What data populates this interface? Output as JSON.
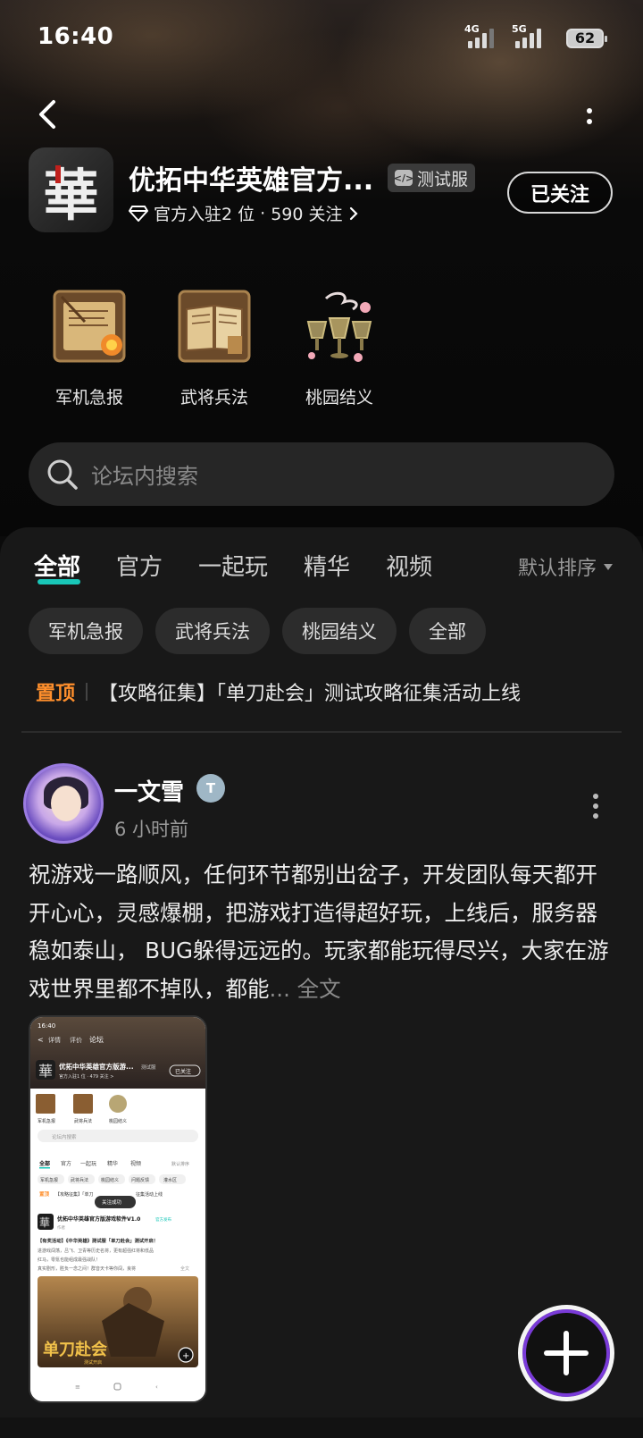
{
  "status_bar": {
    "time": "16:40",
    "signal1": "4G",
    "signal2": "5G",
    "battery": "62"
  },
  "header": {
    "title": "优拓中华英雄官方...",
    "badge": "测试服",
    "rank": "官方入驻2 位",
    "follow_count": "590 关注",
    "follow_button": "已关注",
    "logo_text": "華"
  },
  "categories": [
    {
      "label": "军机急报",
      "icon": "scroll-icon"
    },
    {
      "label": "武将兵法",
      "icon": "book-icon"
    },
    {
      "label": "桃园结义",
      "icon": "goblets-icon"
    }
  ],
  "search": {
    "placeholder": "论坛内搜索"
  },
  "tabs": [
    "全部",
    "官方",
    "一起玩",
    "精华",
    "视频"
  ],
  "sort": {
    "label": "默认排序"
  },
  "chips": [
    "军机急报",
    "武将兵法",
    "桃园结义",
    "全部"
  ],
  "pinned": {
    "tag": "置顶",
    "text": "【攻略征集】「单刀赴会」测试攻略征集活动上线"
  },
  "post": {
    "username": "一文雪",
    "time": "6 小时前",
    "content": "祝游戏一路顺风，任何环节都别出岔子，开发团队每天都开开心心，灵感爆棚，把游戏打造得超好玩，上线后，服务器稳如泰山， BUG躲得远远的。玩家都能玩得尽兴，大家在游戏世界里都不掉队，都能",
    "ellipsis": "... 全文"
  },
  "thumbnail": {
    "time": "16:40",
    "nav": [
      "详情",
      "评价",
      "论坛"
    ],
    "title": "优拓中华英雄官方版游...",
    "badge": "测试服",
    "sub": "官方入驻1 位 · 479 关注 >",
    "follow": "已关注",
    "cats": [
      "军机急报",
      "武将兵法",
      "桃园结义"
    ],
    "search": "论坛内搜索",
    "tabs": [
      "全部",
      "官方",
      "一起玩",
      "精华",
      "视频"
    ],
    "sort": "默认排序",
    "chips": [
      "军机急报",
      "武将兵法",
      "桃园结义",
      "问题反馈",
      "灌水区"
    ],
    "pinned_tag": "置顶",
    "pinned": "【攻略征集】「单刀",
    "pinned_tail": "征集活动上线",
    "toast": "关注成功",
    "post_title": "优拓中华英雄官方版游戏软件V1.0",
    "post_badge": "官方发布",
    "post_author": "作者",
    "post_h": "【有奖活动】《中华英雄》测试服「单刀赴会」测试开启！",
    "post_b1": "进游戏闯荡，吕飞、卫青等历史名将，更有超强红将和低品",
    "post_b2": "红马，零氪也能组成最强战队！",
    "post_b3": "真实剧形，胜负一念之间！群音天卡等你闯，良将",
    "post_more": "全文",
    "banner": "单刀赴会",
    "banner_sub": "测试开启"
  }
}
